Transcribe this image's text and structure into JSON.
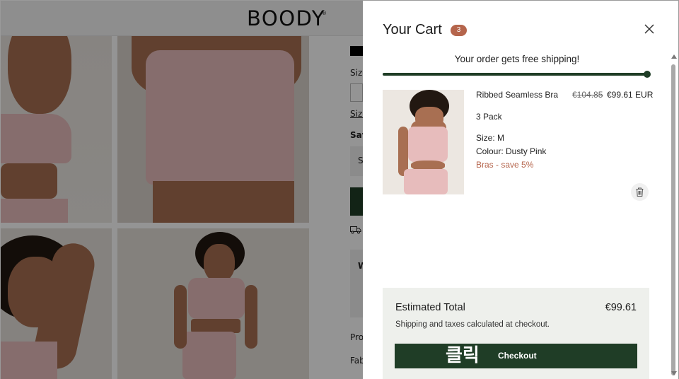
{
  "background_page": {
    "logo": "BOODY",
    "trademark": "®",
    "side_labels": [
      "Size",
      "Size",
      "Sav",
      "S",
      "W",
      "Pro",
      "Fab"
    ]
  },
  "cart": {
    "title": "Your Cart",
    "count": "3",
    "shipping_message": "Your order gets free shipping!",
    "shipping_progress": 1.0,
    "item": {
      "name": "Ribbed Seamless Bra",
      "old_price": "€104.85",
      "price": "€99.61 EUR",
      "pack": "3 Pack",
      "size": "Size: M",
      "colour": "Colour: Dusty Pink",
      "promo": "Bras - save 5%"
    },
    "summary": {
      "estimated_label": "Estimated Total",
      "estimated_value": "€99.61",
      "note": "Shipping and taxes calculated at checkout.",
      "checkout_badge": "클릭",
      "checkout_label": "Checkout"
    }
  },
  "colors": {
    "accent_green": "#1f3d26",
    "badge": "#b5654c"
  },
  "icons": [
    "close-icon",
    "trash-icon",
    "truck-icon"
  ]
}
